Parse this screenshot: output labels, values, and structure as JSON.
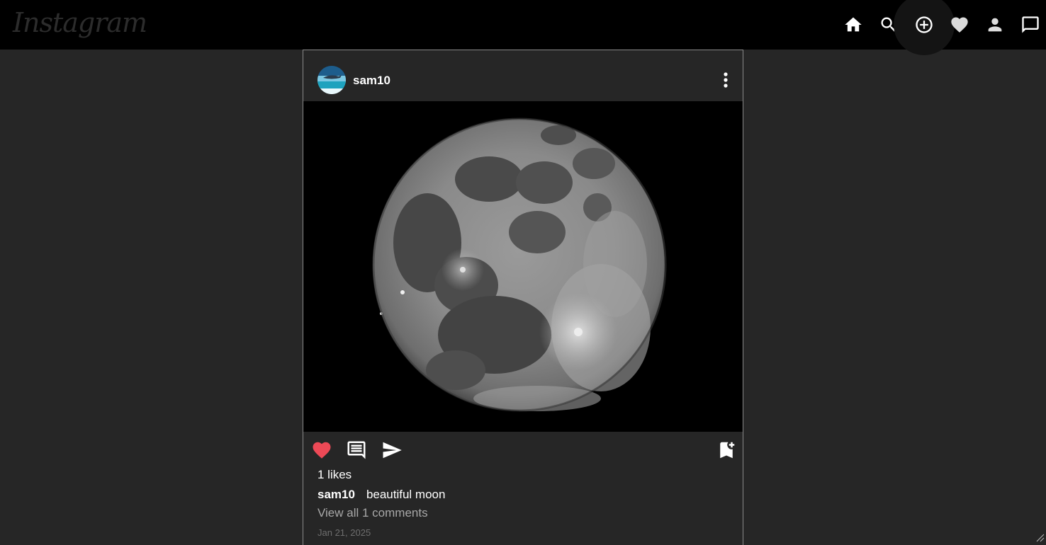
{
  "app": {
    "logo_text": "Instagram"
  },
  "nav": {
    "items": [
      {
        "name": "home",
        "icon": "home-icon"
      },
      {
        "name": "search",
        "icon": "search-icon"
      },
      {
        "name": "create",
        "icon": "add-circle-icon"
      },
      {
        "name": "activity",
        "icon": "heart-icon"
      },
      {
        "name": "profile",
        "icon": "person-icon"
      },
      {
        "name": "messages",
        "icon": "chat-bubble-icon"
      }
    ]
  },
  "post": {
    "username": "sam10",
    "more_icon": "more-vertical-icon",
    "image_description_icon": "moon-photo",
    "liked": true,
    "like_color": "#ed4956",
    "likes_text": "1 likes",
    "caption_user": "sam10",
    "caption_text": "beautiful moon",
    "view_comments_text": "View all 1 comments",
    "date": "Jan 21, 2025"
  },
  "colors": {
    "topbar_bg": "#000000",
    "page_bg": "#262626",
    "logo": "#2c2c2c",
    "muted_text": "#a8a8a8",
    "date_text": "#6e6e6e"
  }
}
